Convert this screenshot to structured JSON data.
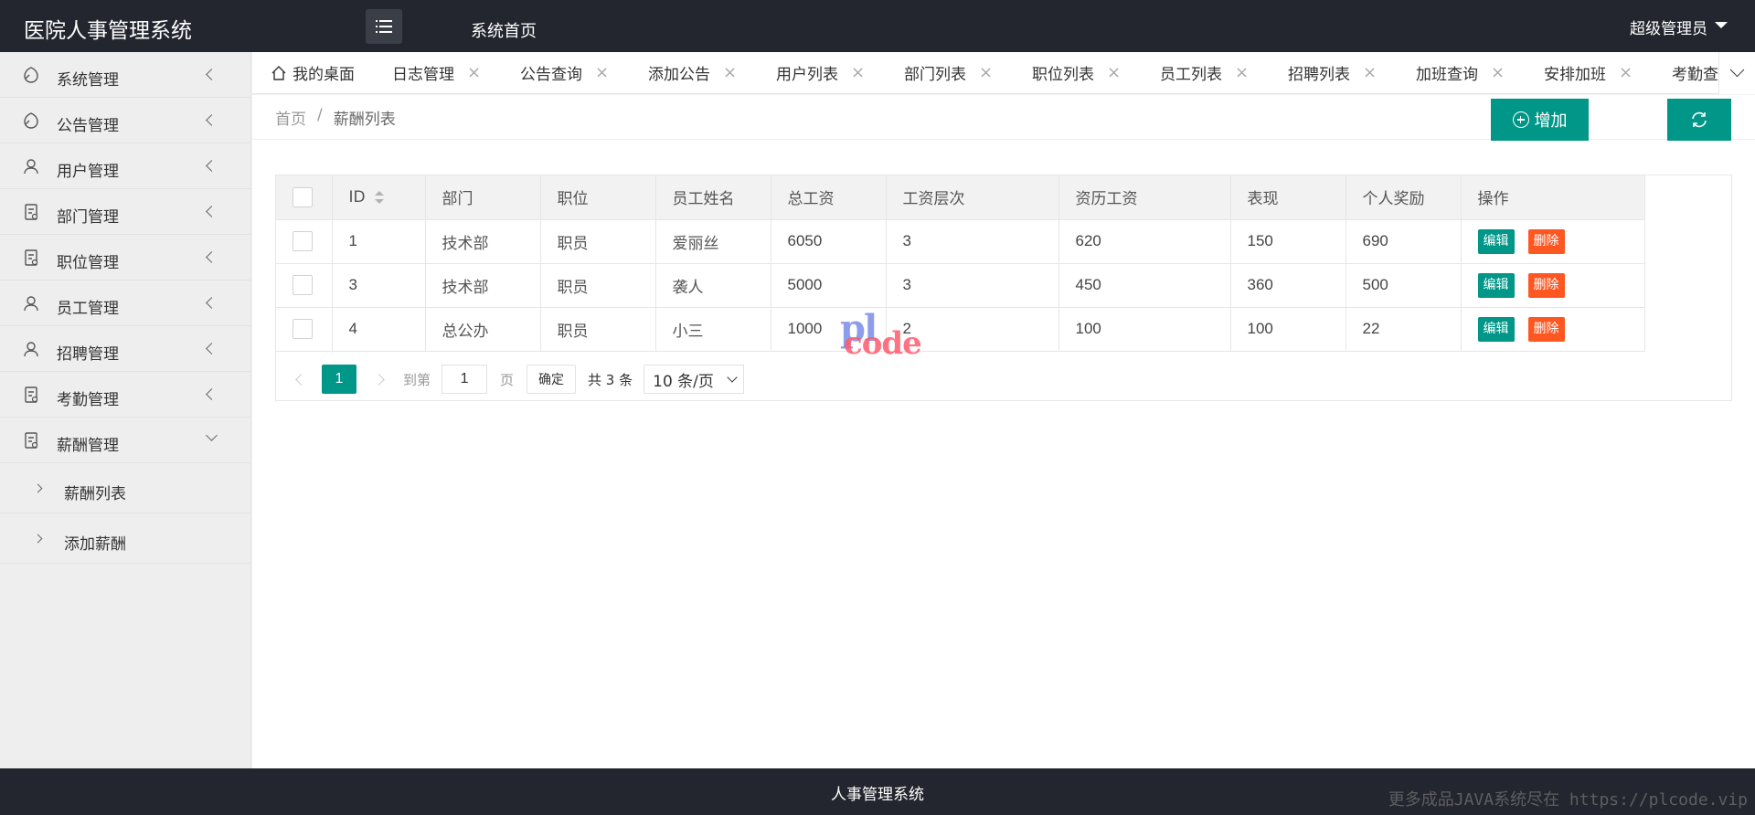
{
  "app": {
    "title": "医院人事管理系统",
    "home_label": "系统首页",
    "user": "超级管理员"
  },
  "sidebar": {
    "items": [
      {
        "label": "系统管理",
        "icon": "leaf-icon"
      },
      {
        "label": "公告管理",
        "icon": "leaf-icon"
      },
      {
        "label": "用户管理",
        "icon": "user-icon"
      },
      {
        "label": "部门管理",
        "icon": "document-icon"
      },
      {
        "label": "职位管理",
        "icon": "document-icon"
      },
      {
        "label": "员工管理",
        "icon": "user-icon"
      },
      {
        "label": "招聘管理",
        "icon": "user-icon"
      },
      {
        "label": "考勤管理",
        "icon": "document-icon"
      },
      {
        "label": "薪酬管理",
        "icon": "document-icon",
        "expanded": true
      }
    ],
    "sub_items": [
      {
        "label": "薪酬列表"
      },
      {
        "label": "添加薪酬"
      }
    ]
  },
  "tabs": [
    {
      "label": "我的桌面",
      "icon": "home-icon"
    },
    {
      "label": "日志管理",
      "close": "×"
    },
    {
      "label": "公告查询",
      "close": "×"
    },
    {
      "label": "添加公告",
      "close": "×"
    },
    {
      "label": "用户列表",
      "close": "×"
    },
    {
      "label": "部门列表",
      "close": "×"
    },
    {
      "label": "职位列表",
      "close": "×"
    },
    {
      "label": "员工列表",
      "close": "×"
    },
    {
      "label": "招聘列表",
      "close": "×"
    },
    {
      "label": "加班查询",
      "close": "×"
    },
    {
      "label": "安排加班",
      "close": "×"
    },
    {
      "label": "考勤查",
      "close": ""
    }
  ],
  "breadcrumb": {
    "home": "首页",
    "separator": "/",
    "current": "薪酬列表"
  },
  "toolbar": {
    "add_label": "增加"
  },
  "table": {
    "headers": [
      "ID",
      "部门",
      "职位",
      "员工姓名",
      "总工资",
      "工资层次",
      "资历工资",
      "表现",
      "个人奖励",
      "操作"
    ],
    "rows": [
      [
        "1",
        "技术部",
        "职员",
        "爱丽丝",
        "6050",
        "3",
        "620",
        "150",
        "690"
      ],
      [
        "3",
        "技术部",
        "职员",
        "袭人",
        "5000",
        "3",
        "450",
        "360",
        "500"
      ],
      [
        "4",
        "总公办",
        "职员",
        "小三",
        "1000",
        "2",
        "100",
        "100",
        "22"
      ]
    ],
    "edit_label": "编辑",
    "delete_label": "删除"
  },
  "pager": {
    "current_page": "1",
    "goto_label": "到第",
    "goto_value": "1",
    "page_label": "页",
    "confirm_label": "确定",
    "total_label": "共 3 条",
    "page_size": "10 条/页"
  },
  "watermark": {
    "top": "pl",
    "bottom": "code"
  },
  "footer": {
    "title": "人事管理系统",
    "watermark": "更多成品JAVA系统尽在 https://plcode.vip"
  },
  "colors": {
    "header_bg": "#23262e",
    "accent": "#009688",
    "danger": "#ff5722",
    "sidebar_bg": "#eeeeee"
  }
}
